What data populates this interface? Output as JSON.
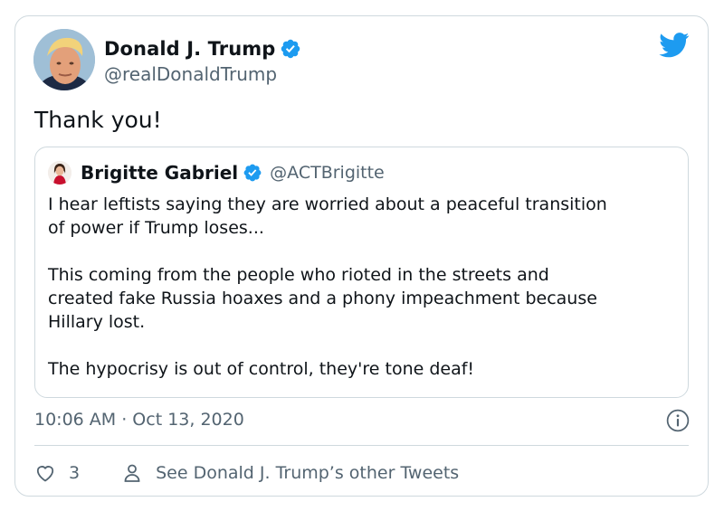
{
  "tweet": {
    "author_name": "Donald J. Trump",
    "author_handle": "@realDonaldTrump",
    "text": "Thank you!",
    "timestamp": "10:06 AM · Oct 13, 2020",
    "like_count": "3",
    "other_tweets_label": "See Donald J. Trump’s other Tweets"
  },
  "quoted": {
    "author_name": "Brigitte Gabriel",
    "author_handle": "@ACTBrigitte",
    "paragraphs": [
      "I hear leftists saying they are worried about a peaceful transition\nof power if Trump loses...",
      "This coming from the people who rioted in the streets and\ncreated fake Russia hoaxes and a phony impeachment because\nHillary lost.",
      "The hypocrisy is out of control, they're tone deaf!"
    ]
  },
  "icons": {
    "verified": "verified-badge-icon",
    "brand": "twitter-bird-icon",
    "info": "info-icon",
    "like": "heart-icon",
    "profile": "person-icon"
  },
  "colors": {
    "brand_blue": "#1d9bf0",
    "text_primary": "#0f1419",
    "text_secondary": "#536471",
    "border": "#cfd9de"
  }
}
